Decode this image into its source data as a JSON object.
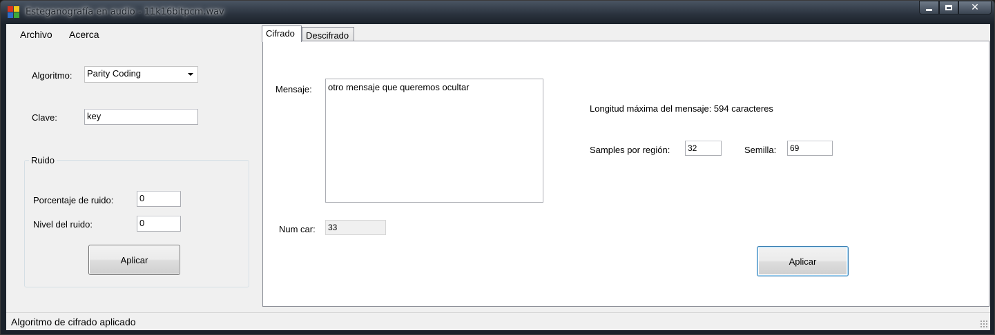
{
  "window": {
    "title": "Esteganografía en audio - 11k16bitpcm.wav"
  },
  "menu": {
    "items": [
      "Archivo",
      "Acerca"
    ]
  },
  "left_panel": {
    "algoritmo_label": "Algoritmo:",
    "algoritmo_value": "Parity Coding",
    "clave_label": "Clave:",
    "clave_value": "key",
    "ruido": {
      "title": "Ruido",
      "porcentaje_label": "Porcentaje de ruido:",
      "porcentaje_value": "0",
      "nivel_label": "Nivel del ruido:",
      "nivel_value": "0",
      "apply_label": "Aplicar"
    }
  },
  "tabs": [
    {
      "label": "Cifrado",
      "active": true
    },
    {
      "label": "Descifrado",
      "active": false
    }
  ],
  "cifrado": {
    "mensaje_label": "Mensaje:",
    "mensaje_value": "otro mensaje que queremos ocultar",
    "longitud_text": "Longitud máxima del mensaje: 594 caracteres",
    "samples_label": "Samples por región:",
    "samples_value": "32",
    "semilla_label": "Semilla:",
    "semilla_value": "69",
    "numcar_label": "Num car:",
    "numcar_value": "33",
    "apply_label": "Aplicar"
  },
  "status": {
    "text": "Algoritmo de cifrado aplicado"
  },
  "colors": {
    "icon_red": "#d9331f",
    "icon_yellow": "#f2c81b",
    "icon_blue": "#2e6cc8",
    "icon_green": "#3ea83a",
    "focus_border": "#3c7fb1"
  }
}
